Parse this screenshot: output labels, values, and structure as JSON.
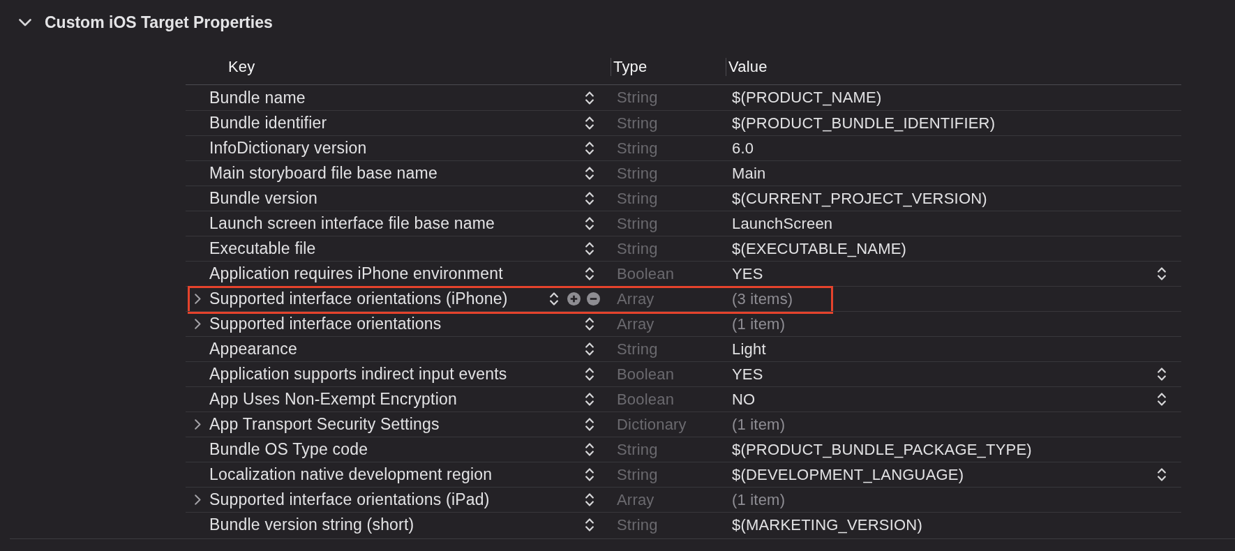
{
  "section": {
    "title": "Custom iOS Target Properties",
    "expanded": true
  },
  "table": {
    "columns": [
      "Key",
      "Type",
      "Value"
    ],
    "rows": [
      {
        "key": "Bundle name",
        "type": "String",
        "value": "$(PRODUCT_NAME)",
        "kind": "value",
        "popup": false,
        "hovered": false,
        "highlighted": false
      },
      {
        "key": "Bundle identifier",
        "type": "String",
        "value": "$(PRODUCT_BUNDLE_IDENTIFIER)",
        "kind": "value",
        "popup": false,
        "hovered": false,
        "highlighted": false
      },
      {
        "key": "InfoDictionary version",
        "type": "String",
        "value": "6.0",
        "kind": "value",
        "popup": false,
        "hovered": false,
        "highlighted": false
      },
      {
        "key": "Main storyboard file base name",
        "type": "String",
        "value": "Main",
        "kind": "value",
        "popup": false,
        "hovered": false,
        "highlighted": false
      },
      {
        "key": "Bundle version",
        "type": "String",
        "value": "$(CURRENT_PROJECT_VERSION)",
        "kind": "value",
        "popup": false,
        "hovered": false,
        "highlighted": false
      },
      {
        "key": "Launch screen interface file base name",
        "type": "String",
        "value": "LaunchScreen",
        "kind": "value",
        "popup": false,
        "hovered": false,
        "highlighted": false
      },
      {
        "key": "Executable file",
        "type": "String",
        "value": "$(EXECUTABLE_NAME)",
        "kind": "value",
        "popup": false,
        "hovered": false,
        "highlighted": false
      },
      {
        "key": "Application requires iPhone environment",
        "type": "Boolean",
        "value": "YES",
        "kind": "value",
        "popup": true,
        "hovered": false,
        "highlighted": false
      },
      {
        "key": "Supported interface orientations (iPhone)",
        "type": "Array",
        "value": "(3 items)",
        "kind": "collection",
        "popup": false,
        "hovered": true,
        "highlighted": true
      },
      {
        "key": "Supported interface orientations",
        "type": "Array",
        "value": "(1 item)",
        "kind": "collection",
        "popup": false,
        "hovered": false,
        "highlighted": false
      },
      {
        "key": "Appearance",
        "type": "String",
        "value": "Light",
        "kind": "value",
        "popup": false,
        "hovered": false,
        "highlighted": false
      },
      {
        "key": "Application supports indirect input events",
        "type": "Boolean",
        "value": "YES",
        "kind": "value",
        "popup": true,
        "hovered": false,
        "highlighted": false
      },
      {
        "key": "App Uses Non-Exempt Encryption",
        "type": "Boolean",
        "value": "NO",
        "kind": "value",
        "popup": true,
        "hovered": false,
        "highlighted": false
      },
      {
        "key": "App Transport Security Settings",
        "type": "Dictionary",
        "value": "(1 item)",
        "kind": "collection",
        "popup": false,
        "hovered": false,
        "highlighted": false
      },
      {
        "key": "Bundle OS Type code",
        "type": "String",
        "value": "$(PRODUCT_BUNDLE_PACKAGE_TYPE)",
        "kind": "value",
        "popup": false,
        "hovered": false,
        "highlighted": false
      },
      {
        "key": "Localization native development region",
        "type": "String",
        "value": "$(DEVELOPMENT_LANGUAGE)",
        "kind": "value",
        "popup": true,
        "hovered": false,
        "highlighted": false
      },
      {
        "key": "Supported interface orientations (iPad)",
        "type": "Array",
        "value": "(1 item)",
        "kind": "collection",
        "popup": false,
        "hovered": false,
        "highlighted": false
      },
      {
        "key": "Bundle version string (short)",
        "type": "String",
        "value": "$(MARKETING_VERSION)",
        "kind": "value",
        "popup": false,
        "hovered": false,
        "highlighted": false
      }
    ]
  }
}
